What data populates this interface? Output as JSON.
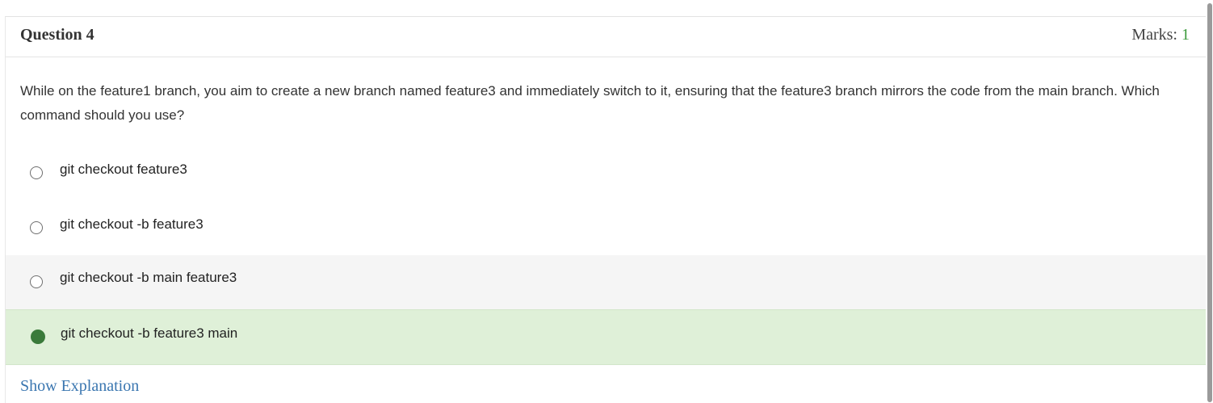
{
  "question": {
    "title": "Question 4",
    "marks_label": "Marks:",
    "marks_value": "1",
    "text": "While on the feature1 branch, you aim to create a new branch named feature3 and immediately switch to it, ensuring that the feature3 branch mirrors the code from the main branch. Which command should you use?"
  },
  "options": [
    {
      "label": "git checkout feature3",
      "selected": false
    },
    {
      "label": "git checkout -b feature3",
      "selected": false
    },
    {
      "label": "git checkout -b main feature3",
      "selected": false,
      "hovered": true
    },
    {
      "label": "git checkout -b feature3 main",
      "selected": true,
      "correct": true
    }
  ],
  "footer": {
    "show_explanation": "Show Explanation"
  },
  "colors": {
    "correct_bg": "#dff0d8",
    "correct_radio": "#3a7a3a",
    "marks_value": "#3c9a3c",
    "link": "#3a76b0",
    "hover_bg": "#f5f5f5"
  }
}
